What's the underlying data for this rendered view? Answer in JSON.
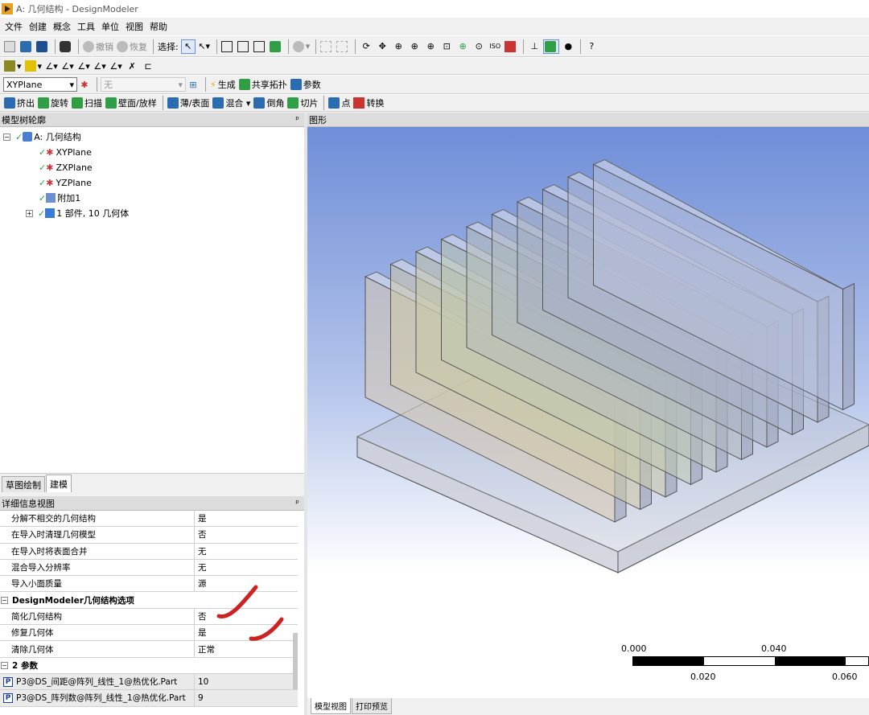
{
  "window": {
    "title": "A: 几何结构 - DesignModeler"
  },
  "menu": [
    "文件",
    "创建",
    "概念",
    "工具",
    "单位",
    "视图",
    "帮助"
  ],
  "toolbar1": {
    "undo": "撤销",
    "redo": "恢复",
    "select_label": "选择:"
  },
  "toolbar3": {
    "plane_select": "XYPlane",
    "sketch_select": "无",
    "generate": "生成",
    "share_topology": "共享拓扑",
    "parameters": "参数"
  },
  "toolbar4": {
    "extrude": "挤出",
    "revolve": "旋转",
    "sweep": "扫描",
    "skin_loft": "壁面/放样",
    "thin_surface": "薄/表面",
    "blend": "混合",
    "chamfer": "倒角",
    "slice": "切片",
    "point": "点",
    "conversion": "转换"
  },
  "tree": {
    "header": "模型树轮廓",
    "pin": "ᵖ",
    "items": [
      {
        "label": "A: 几何结构",
        "indent": 0,
        "icon": "geometry-icon",
        "expander": "−"
      },
      {
        "label": "XYPlane",
        "indent": 1,
        "icon": "plane-icon"
      },
      {
        "label": "ZXPlane",
        "indent": 1,
        "icon": "plane-icon"
      },
      {
        "label": "YZPlane",
        "indent": 1,
        "icon": "plane-icon"
      },
      {
        "label": "附加1",
        "indent": 1,
        "icon": "attach-icon"
      },
      {
        "label": "1 部件, 10 几何体",
        "indent": 0,
        "icon": "parts-icon",
        "expander": "+"
      }
    ]
  },
  "left_tabs": [
    "草图绘制",
    "建模"
  ],
  "details": {
    "header": "详细信息视图",
    "rows": [
      {
        "type": "row",
        "key": "分解不相交的几何结构",
        "value": "是"
      },
      {
        "type": "row",
        "key": "在导入时清理几何模型",
        "value": "否"
      },
      {
        "type": "row",
        "key": "在导入时将表面合并",
        "value": "无"
      },
      {
        "type": "row",
        "key": "混合导入分辨率",
        "value": "无"
      },
      {
        "type": "row",
        "key": "导入小面质量",
        "value": "源"
      },
      {
        "type": "group",
        "key": "DesignModeler几何结构选项",
        "expander": "−"
      },
      {
        "type": "row",
        "key": "简化几何结构",
        "value": "否"
      },
      {
        "type": "row",
        "key": "修复几何体",
        "value": "是"
      },
      {
        "type": "row",
        "key": "清除几何体",
        "value": "正常"
      },
      {
        "type": "group",
        "key": "2 参数",
        "expander": "−"
      },
      {
        "type": "param",
        "badge": "P",
        "key": "P3@DS_间距@阵列_线性_1@热优化.Part",
        "value": "10"
      },
      {
        "type": "param",
        "badge": "P",
        "key": "P3@DS_阵列数@阵列_线性_1@热优化.Part",
        "value": "9"
      }
    ]
  },
  "graphics": {
    "header": "图形",
    "scale": {
      "top_left": "0.000",
      "top_right": "0.040",
      "bottom_left": "0.020",
      "bottom_right": "0.060"
    },
    "fin_count": 10,
    "annotation_color": "#cc2222"
  },
  "bottom_tabs": [
    "模型视图",
    "打印预览"
  ]
}
